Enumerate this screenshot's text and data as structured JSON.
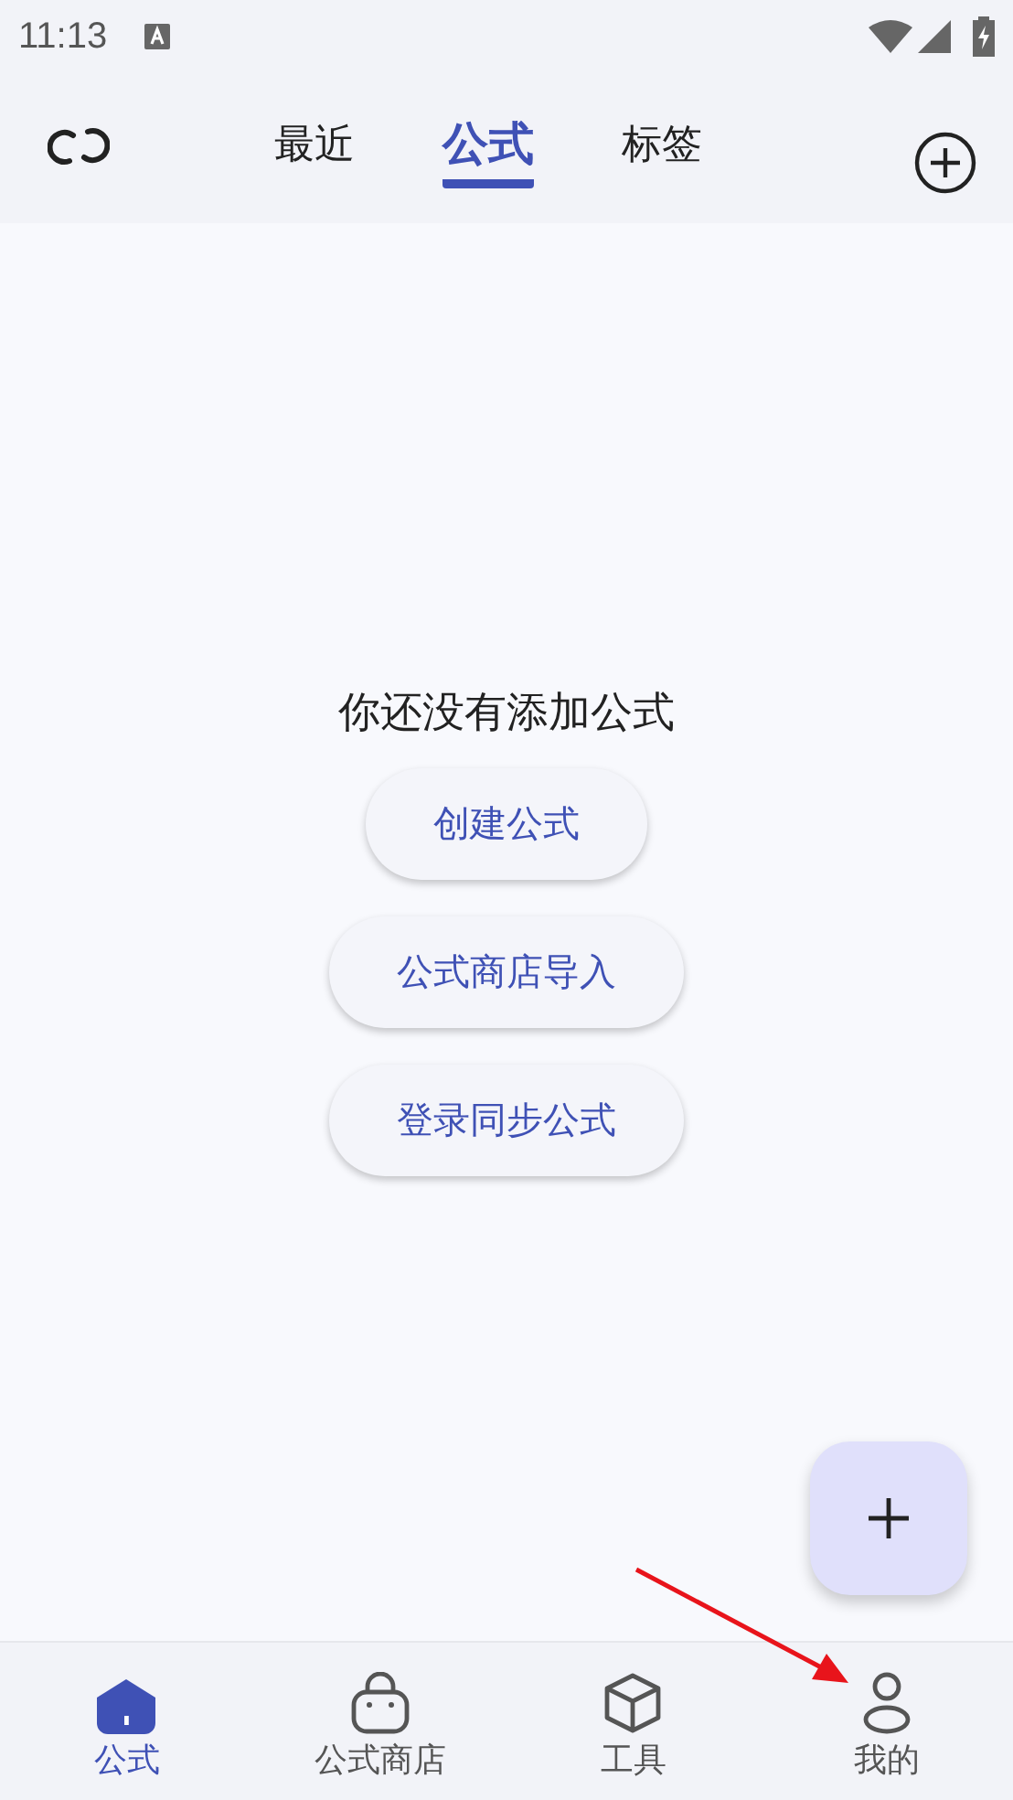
{
  "status_bar": {
    "time": "11:13"
  },
  "tabs": [
    {
      "label": "最近",
      "selected": false
    },
    {
      "label": "公式",
      "selected": true
    },
    {
      "label": "标签",
      "selected": false
    }
  ],
  "empty_state": {
    "message": "你还没有添加公式",
    "actions": [
      "创建公式",
      "公式商店导入",
      "登录同步公式"
    ]
  },
  "bottom_nav": [
    {
      "label": "公式",
      "kind": "home",
      "selected": true
    },
    {
      "label": "公式商店",
      "kind": "store",
      "selected": false
    },
    {
      "label": "工具",
      "kind": "tools",
      "selected": false
    },
    {
      "label": "我的",
      "kind": "profile",
      "selected": false
    }
  ]
}
